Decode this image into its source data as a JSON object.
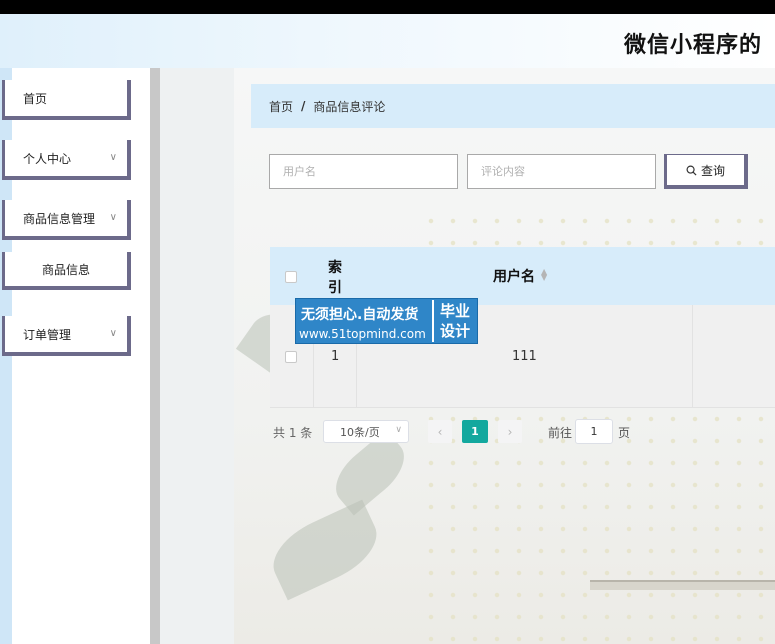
{
  "header": {
    "title": "微信小程序的"
  },
  "sidebar": {
    "items": [
      {
        "label": "首页"
      },
      {
        "label": "个人中心"
      },
      {
        "label": "商品信息管理"
      },
      {
        "label": "商品信息"
      },
      {
        "label": "订单管理"
      }
    ]
  },
  "breadcrumb": {
    "home": "首页",
    "separator": "/",
    "current": "商品信息评论"
  },
  "search": {
    "username_placeholder": "用户名",
    "comment_placeholder": "评论内容",
    "button_label": "查询"
  },
  "table": {
    "headers": {
      "index": "索引",
      "username": "用户名"
    },
    "rows": [
      {
        "index": "1",
        "username": "111"
      }
    ]
  },
  "watermark": {
    "line1": "无须担心.自动发货",
    "line2": "www.51topmind.com",
    "box_line1": "毕业",
    "box_line2": "设计"
  },
  "pagination": {
    "total": "共 1 条",
    "page_size": "10条/页",
    "current_page": "1",
    "goto_label": "前往",
    "goto_value": "1",
    "goto_suffix": "页"
  },
  "colors": {
    "accent": "#13a89e",
    "header_blue": "#d7ecfa",
    "menu_border": "#6c6a8a"
  }
}
